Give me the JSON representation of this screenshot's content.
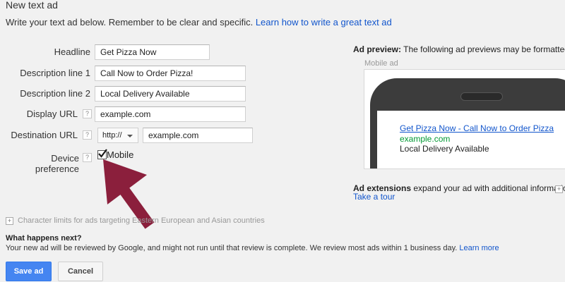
{
  "header": {
    "title": "New text ad",
    "intro_text": "Write your text ad below. Remember to be clear and specific.",
    "intro_link": "Learn how to write a great text ad"
  },
  "form": {
    "headline": {
      "label": "Headline",
      "value": "Get Pizza Now"
    },
    "description1": {
      "label": "Description line 1",
      "value": "Call Now to Order Pizza!"
    },
    "description2": {
      "label": "Description line 2",
      "value": "Local Delivery Available"
    },
    "display_url": {
      "label": "Display URL",
      "value": "example.com"
    },
    "destination_url": {
      "label": "Destination URL",
      "protocol": "http://",
      "value": "example.com"
    },
    "device_preference": {
      "label": "Device preference",
      "option_label": "Mobile",
      "checked": true
    },
    "help_glyph": "?"
  },
  "preview": {
    "label_bold": "Ad preview:",
    "label_text": "The following ad previews may be formatted s",
    "mobile_caption": "Mobile ad",
    "ad": {
      "headline": "Get Pizza Now - Call Now to Order Pizza",
      "url": "example.com",
      "description": "Local Delivery Available"
    }
  },
  "extensions": {
    "label_bold": "Ad extensions",
    "label_text": "expand your ad with additional information",
    "tour_link": "Take a tour"
  },
  "char_limits": {
    "expander": "+",
    "text": "Character limits for ads targeting Eastern European and Asian countries"
  },
  "whats_next": {
    "heading": "What happens next?",
    "text": "Your new ad will be reviewed by Google, and might not run until that review is complete. We review most ads within 1 business day.",
    "link": "Learn more"
  },
  "actions": {
    "save": "Save ad",
    "cancel": "Cancel"
  },
  "colors": {
    "link": "#1155cc",
    "ad_url_green": "#009933",
    "primary_button": "#4585f1",
    "arrow": "#8b1f3c"
  },
  "icons": {
    "checkmark": "checkmark-icon",
    "caret": "chevron-down-icon",
    "arrow": "annotation-arrow-icon"
  }
}
